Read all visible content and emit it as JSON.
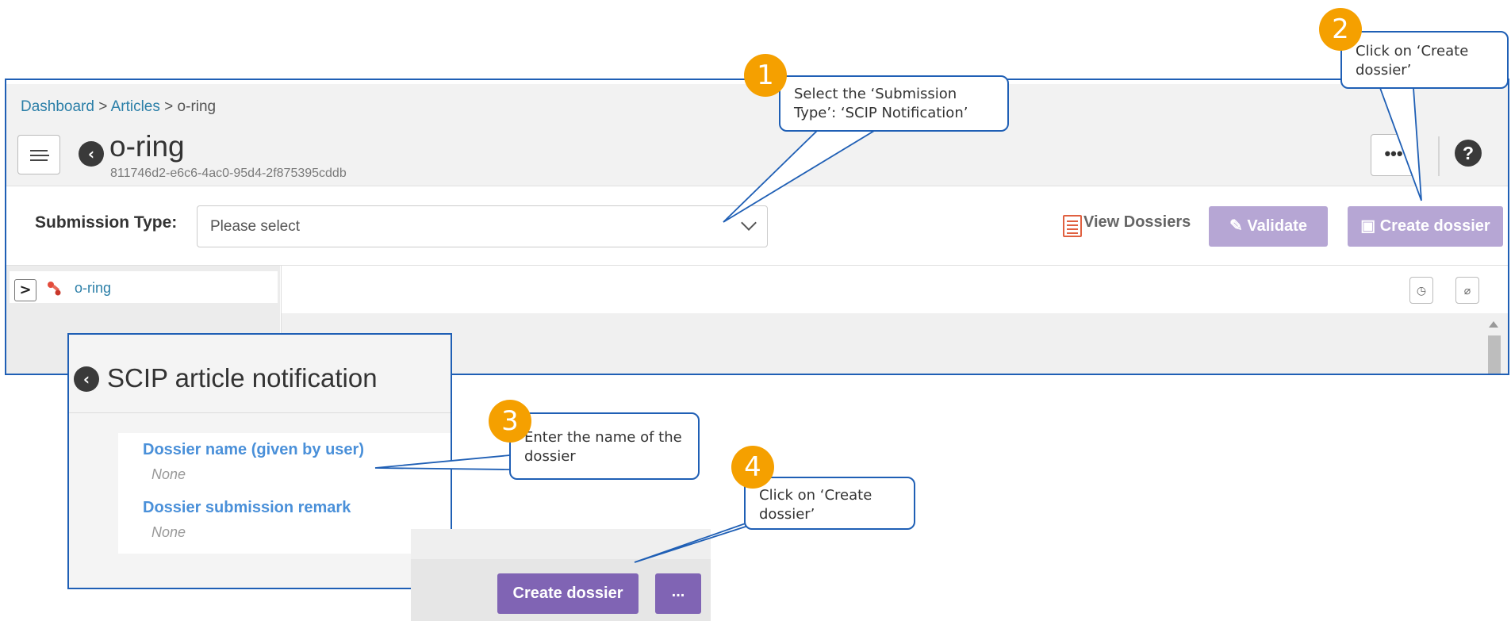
{
  "breadcrumb": {
    "items": [
      "Dashboard",
      "Articles",
      "o-ring"
    ],
    "separator": ">"
  },
  "header": {
    "title": "o-ring",
    "uuid": "811746d2-e6c6-4ac0-95d4-2f875395cddb",
    "more_label": "•••",
    "help_label": "?"
  },
  "submission": {
    "label": "Submission Type:",
    "placeholder": "Please select",
    "view_dossiers_label": "View Dossiers",
    "validate_label": "Validate",
    "create_dossier_label": "Create dossier",
    "disabled_color": "#b6a6d4"
  },
  "tree": {
    "expand_label": ">",
    "items": [
      {
        "label": "o-ring",
        "icon": "article-icon"
      }
    ]
  },
  "scip_panel": {
    "title": "SCIP article notification",
    "fields": [
      {
        "label": "Dossier name (given by user)",
        "value": "None"
      },
      {
        "label": "Dossier submission remark",
        "value": "None"
      }
    ]
  },
  "actions": {
    "create_dossier_label": "Create dossier",
    "more_label": "...",
    "button_color": "#8064b4"
  },
  "callouts": [
    {
      "number": "1",
      "text": "Select the ‘Submission Type’: ‘SCIP Notification’"
    },
    {
      "number": "2",
      "text": "Click on ‘Create dossier’"
    },
    {
      "number": "3",
      "text": "Enter the name of the dossier"
    },
    {
      "number": "4",
      "text": "Click on ‘Create dossier’"
    }
  ],
  "colors": {
    "callout_border": "#1f5fb5",
    "badge": "#f5a000",
    "link": "#2b7fa8",
    "field_label": "#4a90d9"
  }
}
